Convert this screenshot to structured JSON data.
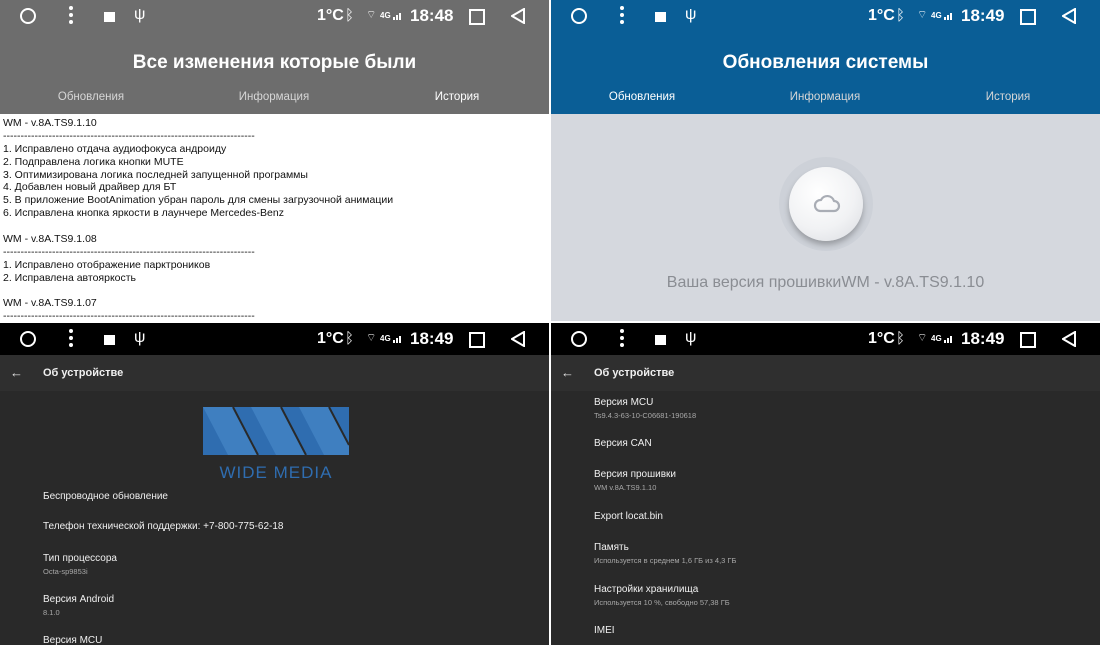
{
  "status": {
    "temp": "1°C",
    "network": "4G",
    "time_panel1": "18:48",
    "time_panel2": "18:49",
    "time_panel3": "18:49",
    "time_panel4": "18:49"
  },
  "panel1": {
    "title": "Все изменения которые были",
    "tabs": [
      "Обновления",
      "Информация",
      "История"
    ],
    "active_tab": "История",
    "lines": [
      "WM - v.8A.TS9.1.10",
      "------------------------------------------------------------------------",
      "1. Исправлено отдача аудиофокуса андроиду",
      "2. Подправлена логика кнопки MUTE",
      "3. Оптимизирована логика последней запущенной программы",
      "4. Добавлен новый драйвер для БТ",
      "5. В приложение BootAnimation убран пароль для смены загрузочной анимации",
      "6. Исправлена кнопка яркости в лаунчере Mercedes-Benz",
      "",
      "WM - v.8A.TS9.1.08",
      "------------------------------------------------------------------------",
      "1. Исправлено отображение парктроников",
      "2. Исправлена автояркость",
      "",
      "WM - v.8A.TS9.1.07",
      "------------------------------------------------------------------------"
    ]
  },
  "panel2": {
    "title": "Обновления системы",
    "tabs": [
      "Обновления",
      "Информация",
      "История"
    ],
    "active_tab": "Обновления",
    "firmware_text": "Ваша версия прошивкиWM - v.8A.TS9.1.10",
    "button_icon": "cloud-icon"
  },
  "panel3": {
    "title": "Об устройстве",
    "logo_text": "WIDE MEDIA",
    "items": [
      {
        "title": "Беспроводное обновление",
        "sub": ""
      },
      {
        "title": "Телефон технической поддержки: +7-800-775-62-18",
        "sub": ""
      },
      {
        "title": "Тип процессора",
        "sub": "Octa-sp9853i"
      },
      {
        "title": "Версия Android",
        "sub": "8.1.0"
      },
      {
        "title": "Версия MCU",
        "sub": ""
      }
    ]
  },
  "panel4": {
    "title": "Об устройстве",
    "items": [
      {
        "title": "Версия MCU",
        "sub": "Ts9.4.3-63-10-C06681-190618"
      },
      {
        "title": "Версия CAN",
        "sub": ""
      },
      {
        "title": "Версия прошивки",
        "sub": "WM v.8A.TS9.1.10"
      },
      {
        "title": "Export locat.bin",
        "sub": ""
      },
      {
        "title": "Память",
        "sub": "Используется в среднем 1,6 ГБ из 4,3 ГБ"
      },
      {
        "title": "Настройки хранилища",
        "sub": "Используется 10 %, свободно 57,38 ГБ"
      },
      {
        "title": "IMEI",
        "sub": ""
      }
    ]
  },
  "colors": {
    "panel1_header": "#6d6d6d",
    "panel2_header": "#0a5e96",
    "dark_bg": "#292929",
    "logo_blue": "#2f6db0"
  }
}
